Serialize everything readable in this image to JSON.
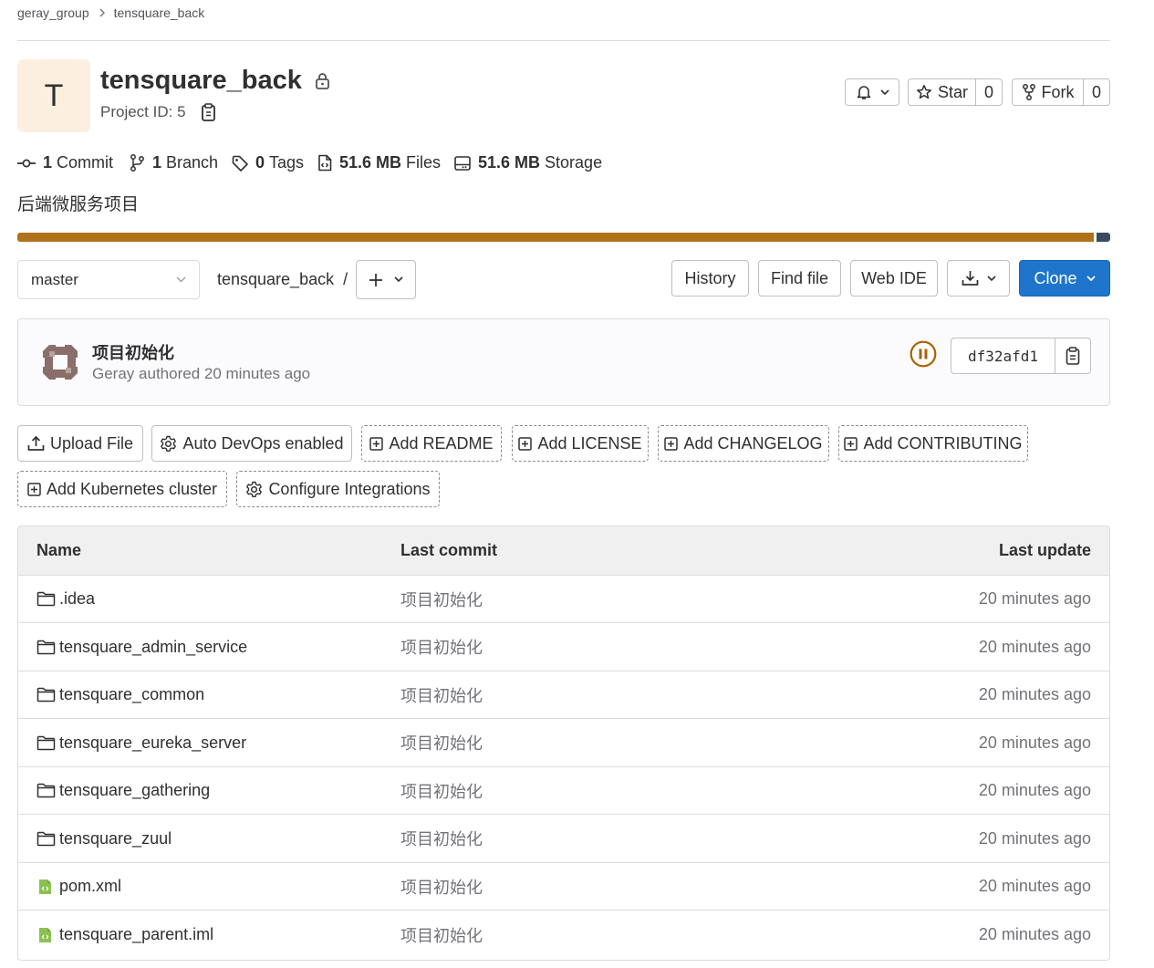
{
  "breadcrumb": {
    "group": "geray_group",
    "project": "tensquare_back"
  },
  "project": {
    "avatar_letter": "T",
    "name": "tensquare_back",
    "id_label": "Project ID: 5",
    "description": "后端微服务项目"
  },
  "actions": {
    "star_label": "Star",
    "star_count": "0",
    "fork_label": "Fork",
    "fork_count": "0"
  },
  "stats": {
    "commits_count": "1",
    "commits_label": "Commit",
    "branches_count": "1",
    "branches_label": "Branch",
    "tags_count": "0",
    "tags_label": "Tags",
    "files_size": "51.6 MB",
    "files_label": "Files",
    "storage_size": "51.6 MB",
    "storage_label": "Storage"
  },
  "language_bar": {
    "colors": [
      "#b07219",
      "#3a4b5f"
    ],
    "fractions": [
      0.985,
      0.015
    ]
  },
  "toolbar": {
    "branch": "master",
    "path_root": "tensquare_back",
    "path_sep": "/",
    "history": "History",
    "find_file": "Find file",
    "web_ide": "Web IDE",
    "clone": "Clone"
  },
  "last_commit": {
    "title": "项目初始化",
    "author": "Geray",
    "authored_text": "authored",
    "time": "20 minutes ago",
    "sha": "df32afd1",
    "pipeline_status": "paused"
  },
  "quick_actions": [
    {
      "label": "Upload File",
      "icon": "upload-icon"
    },
    {
      "label": "Auto DevOps enabled",
      "icon": "settings-icon"
    },
    {
      "label": "Add README",
      "icon": "plus-square-icon"
    },
    {
      "label": "Add LICENSE",
      "icon": "plus-square-icon"
    },
    {
      "label": "Add CHANGELOG",
      "icon": "plus-square-icon"
    },
    {
      "label": "Add CONTRIBUTING",
      "icon": "plus-square-icon"
    },
    {
      "label": "Add Kubernetes cluster",
      "icon": "plus-square-icon"
    },
    {
      "label": "Configure Integrations",
      "icon": "settings-icon"
    }
  ],
  "files_table": {
    "headers": {
      "name": "Name",
      "last_commit": "Last commit",
      "last_update": "Last update"
    },
    "rows": [
      {
        "name": ".idea",
        "type": "folder",
        "commit": "项目初始化",
        "updated": "20 minutes ago"
      },
      {
        "name": "tensquare_admin_service",
        "type": "folder",
        "commit": "项目初始化",
        "updated": "20 minutes ago"
      },
      {
        "name": "tensquare_common",
        "type": "folder",
        "commit": "项目初始化",
        "updated": "20 minutes ago"
      },
      {
        "name": "tensquare_eureka_server",
        "type": "folder",
        "commit": "项目初始化",
        "updated": "20 minutes ago"
      },
      {
        "name": "tensquare_gathering",
        "type": "folder",
        "commit": "项目初始化",
        "updated": "20 minutes ago"
      },
      {
        "name": "tensquare_zuul",
        "type": "folder",
        "commit": "项目初始化",
        "updated": "20 minutes ago"
      },
      {
        "name": "pom.xml",
        "type": "file",
        "commit": "项目初始化",
        "updated": "20 minutes ago"
      },
      {
        "name": "tensquare_parent.iml",
        "type": "file",
        "commit": "项目初始化",
        "updated": "20 minutes ago"
      }
    ]
  }
}
